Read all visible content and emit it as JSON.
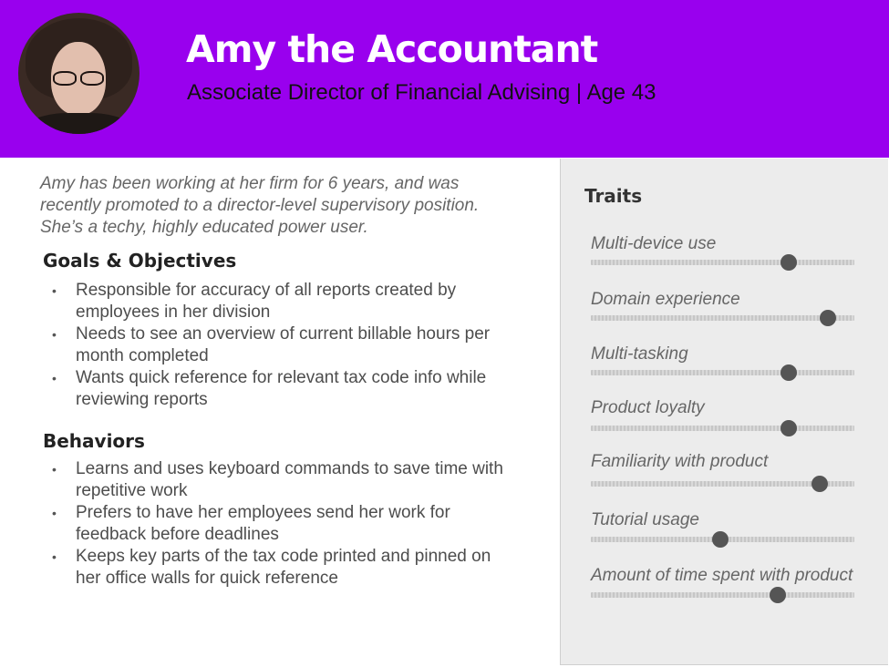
{
  "persona": {
    "name": "Amy the Accountant",
    "role": "Associate Director of Financial Advising",
    "separator": "|",
    "age": "Age 43",
    "intro": "Amy has been working at her firm for 6 years, and was recently promoted to a director-level supervisory position. She’s a techy, highly educated power user."
  },
  "goals": {
    "title": "Goals & Objectives",
    "items": [
      "Responsible for accuracy of all reports created by employees in her division",
      "Needs to see an overview of current billable hours per month completed",
      "Wants quick reference for relevant tax code info while reviewing reports"
    ]
  },
  "behaviors": {
    "title": "Behaviors",
    "items": [
      "Learns and uses keyboard commands to save time with repetitive work",
      "Prefers to have her employees send her work for feedback before deadlines",
      "Keeps key parts of the tax code printed and pinned on her office walls for quick reference"
    ]
  },
  "traits": {
    "title": "Traits",
    "items": [
      {
        "label": "Multi-device use",
        "level": 0.75
      },
      {
        "label": "Domain experience",
        "level": 0.9
      },
      {
        "label": "Multi-tasking",
        "level": 0.75
      },
      {
        "label": "Product loyalty",
        "level": 0.75
      },
      {
        "label": "Familiarity with product",
        "level": 0.87
      },
      {
        "label": "Tutorial usage",
        "level": 0.49
      },
      {
        "label": "Amount of time spent with product",
        "level": 0.71
      }
    ]
  },
  "colors": {
    "header": "#9900ee",
    "title_text": "#ffffff",
    "knob": "#555555",
    "panel": "#ececec"
  }
}
